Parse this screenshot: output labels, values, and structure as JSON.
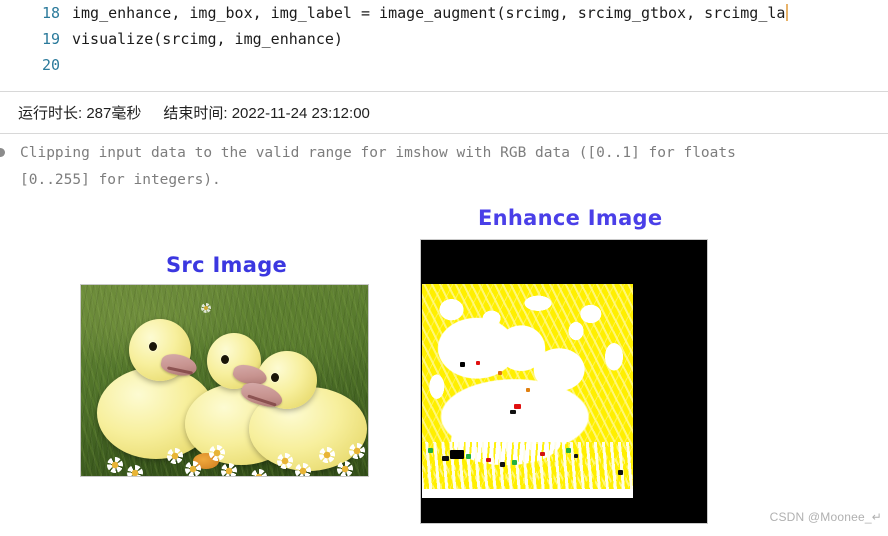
{
  "editor": {
    "lines": [
      {
        "number": "18",
        "code": "img_enhance, img_box, img_label = image_augment(srcimg, srcimg_gtbox, srcimg_la"
      },
      {
        "number": "19",
        "code": "visualize(srcimg, img_enhance)"
      },
      {
        "number": "20",
        "code": ""
      }
    ],
    "line_number_color": "#2b7a9b",
    "caret_color": "#e8b36a"
  },
  "status": {
    "duration": "运行时长: 287毫秒",
    "end_time": "结束时间: 2022-11-24 23:12:00"
  },
  "output": {
    "warning_line1": "Clipping input data to the valid range for imshow with RGB data ([0..1] for floats",
    "warning_line2": "[0..255] for integers).",
    "warning_color": "#7d7d7d"
  },
  "figure": {
    "src_panel": {
      "title": "Src Image",
      "title_color": "#3b37e0",
      "image_alt": "three yellow ducklings sitting in green grass with white daisies"
    },
    "enhance_panel": {
      "title": "Enhance Image",
      "title_color": "#4a3fe8",
      "background_color": "#000000",
      "image_alt": "saturation clipped version of the ducklings photo rendered in yellow and white",
      "primary_color": "#ffef00",
      "secondary_color": "#ffffff"
    }
  },
  "watermark": {
    "text": "CSDN @Moonee_↵"
  }
}
